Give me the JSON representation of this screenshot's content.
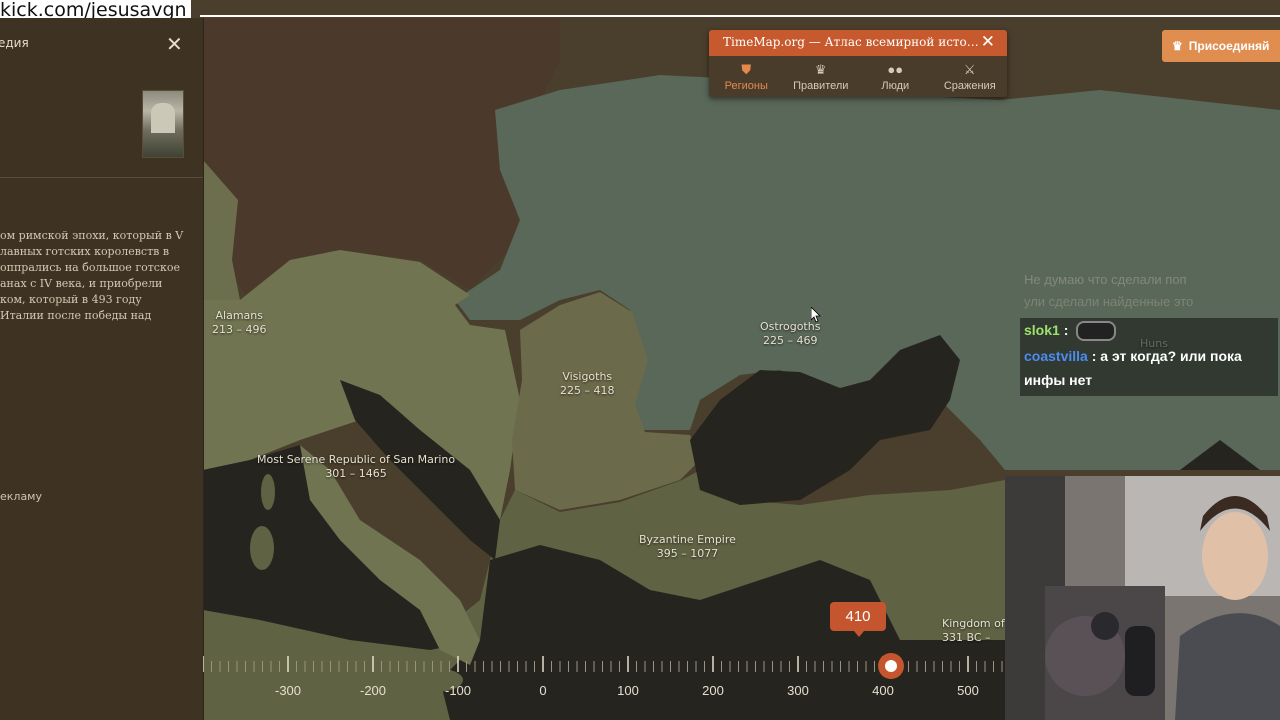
{
  "stream_url": "kick.com/jesusavgn",
  "sidebar": {
    "title_fragment": "едия",
    "description_lines": [
      "ом римской эпохи, который в V",
      "лавных готских королевств в",
      "оппрались на большое готское",
      "анах с IV века, и приобрели",
      "ком, который в 493 году",
      "Италии после победы над"
    ],
    "ad_text": "екламу"
  },
  "timemap": {
    "title": "TimeMap.org — Атлас всемирной исто…",
    "tabs": [
      {
        "label": "Регионы",
        "icon": "shield-icon",
        "active": true
      },
      {
        "label": "Правители",
        "icon": "crown-icon",
        "active": false
      },
      {
        "label": "Люди",
        "icon": "people-icon",
        "active": false
      },
      {
        "label": "Сражения",
        "icon": "swords-icon",
        "active": false
      }
    ]
  },
  "join_button": {
    "label": "Присоединяй"
  },
  "map_labels": [
    {
      "name": "Alamans",
      "dates": "213 – 496"
    },
    {
      "name": "Ostrogoths",
      "dates": "225 – 469"
    },
    {
      "name": "Visigoths",
      "dates": "225 – 418"
    },
    {
      "name": "Most Serene Republic of San Marino",
      "dates": "301 – 1465"
    },
    {
      "name": "Byzantine Empire",
      "dates": "395 – 1077"
    },
    {
      "name": "Kingdom of A",
      "dates": "331 BC –"
    },
    {
      "name": "Huns",
      "dates": ""
    }
  ],
  "chat": {
    "ghost_line1": "Не думаю что сделали поп",
    "ghost_line2": "ули сделали найденные это",
    "messages": [
      {
        "user": "slok1",
        "text": ""
      },
      {
        "user": "coastvilla",
        "text": "а эт когда? или пока инфы нет"
      }
    ]
  },
  "timeline": {
    "current_year": "410",
    "ticks": [
      "-300",
      "-200",
      "-100",
      "0",
      "100",
      "200",
      "300",
      "400",
      "500"
    ]
  },
  "colors": {
    "accent": "#c4552e",
    "join": "#e08e50",
    "ostrogoths": "#5b6a5c",
    "visigoths": "#6b6a4a",
    "roman": "#707451",
    "land_dark": "#443726",
    "sea": "#26241f"
  }
}
